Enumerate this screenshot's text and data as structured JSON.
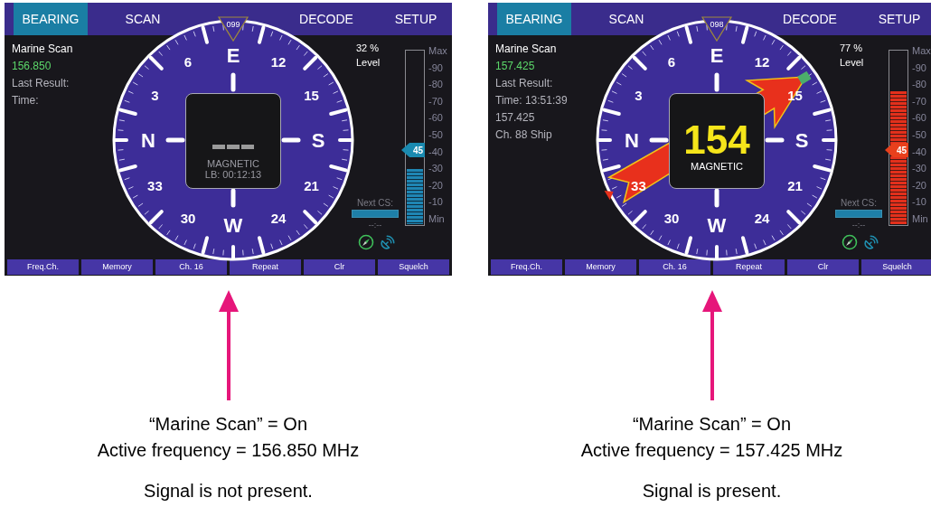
{
  "screens": [
    {
      "signal": false,
      "tabs": [
        {
          "label": "BEARING",
          "selected": true
        },
        {
          "label": "SCAN",
          "selected": false
        },
        {
          "label": "DECODE",
          "selected": false
        },
        {
          "label": "SETUP",
          "selected": false
        }
      ],
      "heading": "099",
      "info": [
        {
          "text": "Marine Scan",
          "kind": "title"
        },
        {
          "text": "156.850",
          "kind": "frequency"
        },
        {
          "text": "Last Result:",
          "kind": "plain"
        },
        {
          "text": "Time:",
          "kind": "plain"
        }
      ],
      "compass_labels": [
        "E",
        "6",
        "12",
        "3",
        "15",
        "N",
        "S",
        "33",
        "21",
        "30",
        "W",
        "24"
      ],
      "center": {
        "lines": [
          "MAGNETIC",
          "LB: 00:12:13"
        ]
      },
      "meter": {
        "level": 0.32,
        "level_text": "32 %",
        "level_label": "Level",
        "scale": [
          "Max",
          "-90",
          "-80",
          "-70",
          "-60",
          "-50",
          "-40",
          "-30",
          "-20",
          "-10",
          "Min"
        ],
        "marker": "45"
      },
      "next_cs": {
        "label": "Next CS:",
        "time": "--:--"
      },
      "buttons": [
        "Freq.Ch.",
        "Memory",
        "Ch. 16",
        "Repeat",
        "Clr",
        "Squelch"
      ],
      "caption": [
        "“Marine Scan” = On",
        "Active frequency = 156.850 MHz"
      ],
      "note": "Signal is not present."
    },
    {
      "signal": true,
      "tabs": [
        {
          "label": "BEARING",
          "selected": true
        },
        {
          "label": "SCAN",
          "selected": false
        },
        {
          "label": "DECODE",
          "selected": false
        },
        {
          "label": "SETUP",
          "selected": false
        }
      ],
      "heading": "098",
      "info": [
        {
          "text": "Marine Scan",
          "kind": "title"
        },
        {
          "text": "157.425",
          "kind": "frequency"
        },
        {
          "text": "Last Result:",
          "kind": "plain"
        },
        {
          "text": "Time: 13:51:39",
          "kind": "plain"
        },
        {
          "text": "157.425",
          "kind": "plain"
        },
        {
          "text": "Ch. 88 Ship",
          "kind": "plain"
        }
      ],
      "compass_labels": [
        "E",
        "6",
        "12",
        "3",
        "15",
        "N",
        "S",
        "33",
        "21",
        "30",
        "W",
        "24"
      ],
      "center": {
        "bearing": "154",
        "lines": [
          "MAGNETIC"
        ]
      },
      "meter": {
        "level": 0.77,
        "level_text": "77 %",
        "level_label": "Level",
        "scale": [
          "Max",
          "-90",
          "-80",
          "-70",
          "-60",
          "-50",
          "-40",
          "-30",
          "-20",
          "-10",
          "Min"
        ],
        "marker": "45"
      },
      "next_cs": {
        "label": "Next CS:",
        "time": "--:--"
      },
      "buttons": [
        "Freq.Ch.",
        "Memory",
        "Ch. 16",
        "Repeat",
        "Clr",
        "Squelch"
      ],
      "caption": [
        "“Marine Scan” = On",
        "Active frequency = 157.425 MHz"
      ],
      "note": "Signal is present."
    }
  ]
}
